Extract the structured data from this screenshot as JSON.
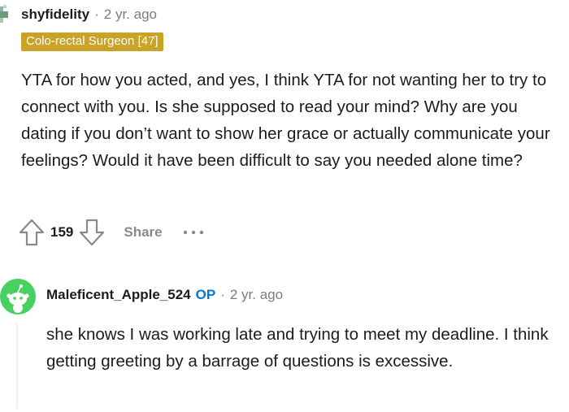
{
  "comments": [
    {
      "author": "shyfidelity",
      "separator": "·",
      "time": "2 yr. ago",
      "flair": "Colo-rectal Surgeon [47]",
      "flair_color": "#c9a227",
      "body": "YTA for how you acted, and yes, I think YTA for not wanting her to try to connect with you. Is she supposed to read your mind? Why are you dating if you don’t want to show her grace or actually communicate your feelings? Would it have been difficult to say you needed alone time?",
      "actions": {
        "upvote_icon": "upvote-arrow-icon",
        "vote_count": "159",
        "downvote_icon": "downvote-arrow-icon",
        "share_label": "Share",
        "more_icon": "ellipsis-icon"
      }
    },
    {
      "author": "Maleficent_Apple_524",
      "op_badge": "OP",
      "op_color": "#0079d3",
      "separator": "·",
      "time": "2 yr. ago",
      "avatar_color": "#46d160",
      "body": "she knows I was working late and trying to meet my deadline. I think getting greeting by a barrage of questions is excessive."
    }
  ]
}
